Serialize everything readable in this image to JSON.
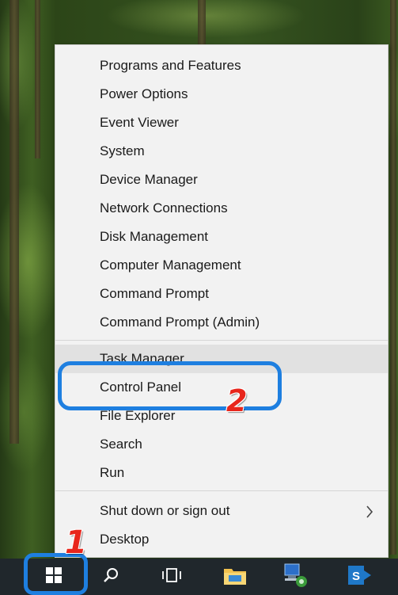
{
  "menu": {
    "items": [
      {
        "label": "Programs and Features"
      },
      {
        "label": "Power Options"
      },
      {
        "label": "Event Viewer"
      },
      {
        "label": "System"
      },
      {
        "label": "Device Manager"
      },
      {
        "label": "Network Connections"
      },
      {
        "label": "Disk Management"
      },
      {
        "label": "Computer Management"
      },
      {
        "label": "Command Prompt"
      },
      {
        "label": "Command Prompt (Admin)"
      },
      {
        "label": "Task Manager"
      },
      {
        "label": "Control Panel"
      },
      {
        "label": "File Explorer"
      },
      {
        "label": "Search"
      },
      {
        "label": "Run"
      },
      {
        "label": "Shut down or sign out",
        "submenu_icon": "chevron-right-icon"
      },
      {
        "label": "Desktop"
      }
    ]
  },
  "annotations": {
    "step1": "1",
    "step2": "2",
    "color": "#1e7fe0",
    "number_color": "#e8261c"
  },
  "taskbar": {
    "buttons": [
      {
        "icon": "windows-start-icon"
      },
      {
        "icon": "search-icon"
      },
      {
        "icon": "task-view-icon"
      },
      {
        "icon": "file-explorer-icon"
      },
      {
        "icon": "network-app-icon"
      },
      {
        "icon": "skype-business-icon"
      }
    ],
    "background": "#20272c"
  }
}
